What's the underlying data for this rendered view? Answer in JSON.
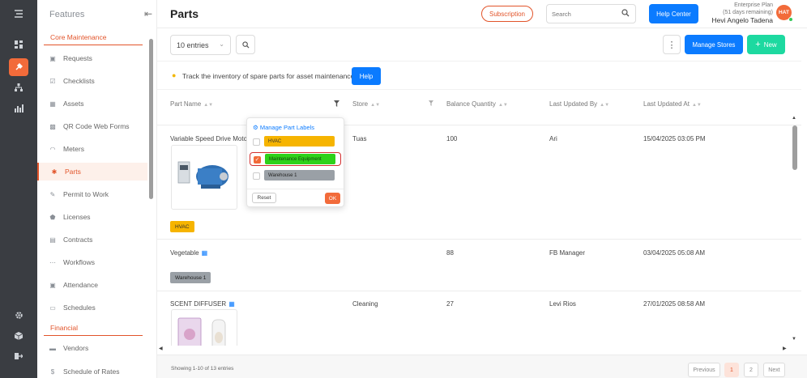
{
  "header": {
    "title": "Parts",
    "subscription_label": "Subscription",
    "search_placeholder": "Search",
    "help_center_label": "Help Center",
    "plan_line1": "Enterprise Plan",
    "plan_line2": "(51 days remaining)",
    "user_name": "Hevi Angelo Tadena",
    "avatar_initials": "HAT"
  },
  "sidebar": {
    "title": "Features",
    "section_core": "Core Maintenance",
    "section_financial": "Financial",
    "items": [
      {
        "label": "Requests",
        "icon": "request-icon"
      },
      {
        "label": "Checklists",
        "icon": "checklist-icon"
      },
      {
        "label": "Assets",
        "icon": "asset-icon"
      },
      {
        "label": "QR Code Web Forms",
        "icon": "qr-icon"
      },
      {
        "label": "Meters",
        "icon": "meter-icon"
      },
      {
        "label": "Parts",
        "icon": "parts-icon"
      },
      {
        "label": "Permit to Work",
        "icon": "permit-icon"
      },
      {
        "label": "Licenses",
        "icon": "license-icon"
      },
      {
        "label": "Contracts",
        "icon": "contract-icon"
      },
      {
        "label": "Workflows",
        "icon": "workflow-icon"
      },
      {
        "label": "Attendance",
        "icon": "attendance-icon"
      },
      {
        "label": "Schedules",
        "icon": "schedule-icon"
      }
    ],
    "financial_items": [
      {
        "label": "Vendors",
        "icon": "vendor-icon"
      },
      {
        "label": "Schedule of Rates",
        "icon": "rates-icon"
      }
    ]
  },
  "toolbar": {
    "entries_value": "10 entries",
    "manage_stores_label": "Manage Stores",
    "new_label": "New"
  },
  "banner": {
    "text": "Track the inventory of spare parts for asset maintenance",
    "help_label": "Help"
  },
  "table": {
    "columns": [
      "Part Name",
      "Store",
      "Balance Quantity",
      "Last Updated By",
      "Last Updated At"
    ],
    "rows": [
      {
        "name": "Variable Speed Drive Moto",
        "store": "Tuas",
        "qty": "100",
        "by": "Ari",
        "at": "15/04/2025 03:05 PM",
        "tag": "HVAC"
      },
      {
        "name": "Vegetable",
        "store": "",
        "qty": "88",
        "by": "FB Manager",
        "at": "03/04/2025 05:08 AM",
        "tag": "Warehouse 1"
      },
      {
        "name": "SCENT DIFFUSER",
        "store": "Cleaning",
        "qty": "27",
        "by": "Levi Rios",
        "at": "27/01/2025 08:58 AM",
        "tag": ""
      }
    ]
  },
  "dropdown": {
    "manage_label": "Manage Part Labels",
    "options": [
      {
        "label": "HVAC",
        "checked": false
      },
      {
        "label": "Maintenance Equipment",
        "checked": true
      },
      {
        "label": "Warehouse 1",
        "checked": false
      }
    ],
    "reset_label": "Reset",
    "ok_label": "OK"
  },
  "footer": {
    "info": "Showing 1-10 of 13 entries",
    "previous_label": "Previous",
    "page1": "1",
    "page2": "2",
    "next_label": "Next"
  },
  "colors": {
    "accent": "#f26b3a",
    "primary": "#0b7bff",
    "new_button": "#1dd9a0",
    "rail": "#3a3d42"
  }
}
